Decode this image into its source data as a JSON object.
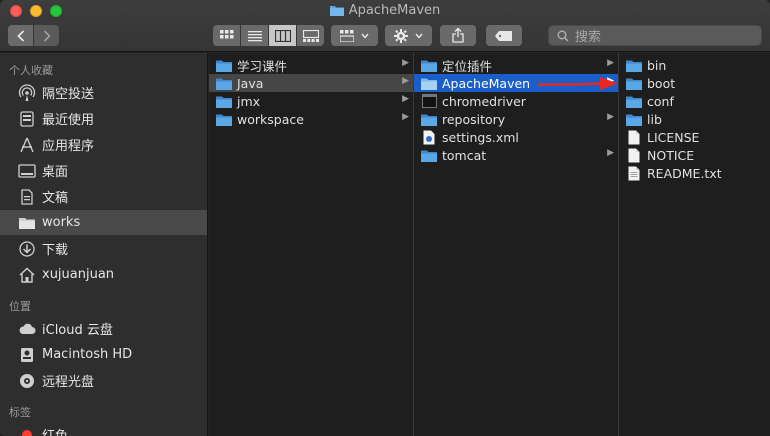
{
  "window": {
    "title": "ApacheMaven"
  },
  "toolbar": {
    "back_icon": "chevron-left-icon",
    "forward_icon": "chevron-right-icon",
    "search_placeholder": "搜索"
  },
  "sidebar": {
    "sections": [
      {
        "header": "个人收藏"
      },
      {
        "header": "位置"
      },
      {
        "header": "标签"
      }
    ],
    "favorites": [
      {
        "label": "隔空投送",
        "icon": "airdrop-icon"
      },
      {
        "label": "最近使用",
        "icon": "recents-icon"
      },
      {
        "label": "应用程序",
        "icon": "applications-icon"
      },
      {
        "label": "桌面",
        "icon": "desktop-icon"
      },
      {
        "label": "文稿",
        "icon": "documents-icon"
      },
      {
        "label": "works",
        "icon": "folder-icon",
        "selected": true
      },
      {
        "label": "下载",
        "icon": "downloads-icon"
      },
      {
        "label": "xujuanjuan",
        "icon": "home-icon"
      }
    ],
    "locations": [
      {
        "label": "iCloud 云盘",
        "icon": "icloud-icon"
      },
      {
        "label": "Macintosh HD",
        "icon": "harddisk-icon"
      },
      {
        "label": "远程光盘",
        "icon": "optical-disc-icon"
      }
    ],
    "tags": [
      {
        "label": "红色",
        "color": "#ff3b30"
      }
    ]
  },
  "columns": {
    "col1": [
      {
        "name": "学习课件",
        "type": "folder",
        "has_children": true
      },
      {
        "name": "Java",
        "type": "folder",
        "has_children": true,
        "selected": true
      },
      {
        "name": "jmx",
        "type": "folder",
        "has_children": true
      },
      {
        "name": "workspace",
        "type": "folder",
        "has_children": true
      }
    ],
    "col2": [
      {
        "name": "定位插件",
        "type": "folder",
        "has_children": true
      },
      {
        "name": "ApacheMaven",
        "type": "folder",
        "has_children": true,
        "selected": true
      },
      {
        "name": "chromedriver",
        "type": "exec",
        "has_children": false
      },
      {
        "name": "repository",
        "type": "folder",
        "has_children": true
      },
      {
        "name": "settings.xml",
        "type": "xml",
        "has_children": false
      },
      {
        "name": "tomcat",
        "type": "folder",
        "has_children": true
      }
    ],
    "col3": [
      {
        "name": "bin",
        "type": "folder"
      },
      {
        "name": "boot",
        "type": "folder"
      },
      {
        "name": "conf",
        "type": "folder"
      },
      {
        "name": "lib",
        "type": "folder"
      },
      {
        "name": "LICENSE",
        "type": "file"
      },
      {
        "name": "NOTICE",
        "type": "file"
      },
      {
        "name": "README.txt",
        "type": "file"
      }
    ]
  },
  "colors": {
    "selection_blue": "#1a5fc9",
    "folder_blue": "#5aa7e6",
    "annotation_arrow": "#e8281e"
  }
}
